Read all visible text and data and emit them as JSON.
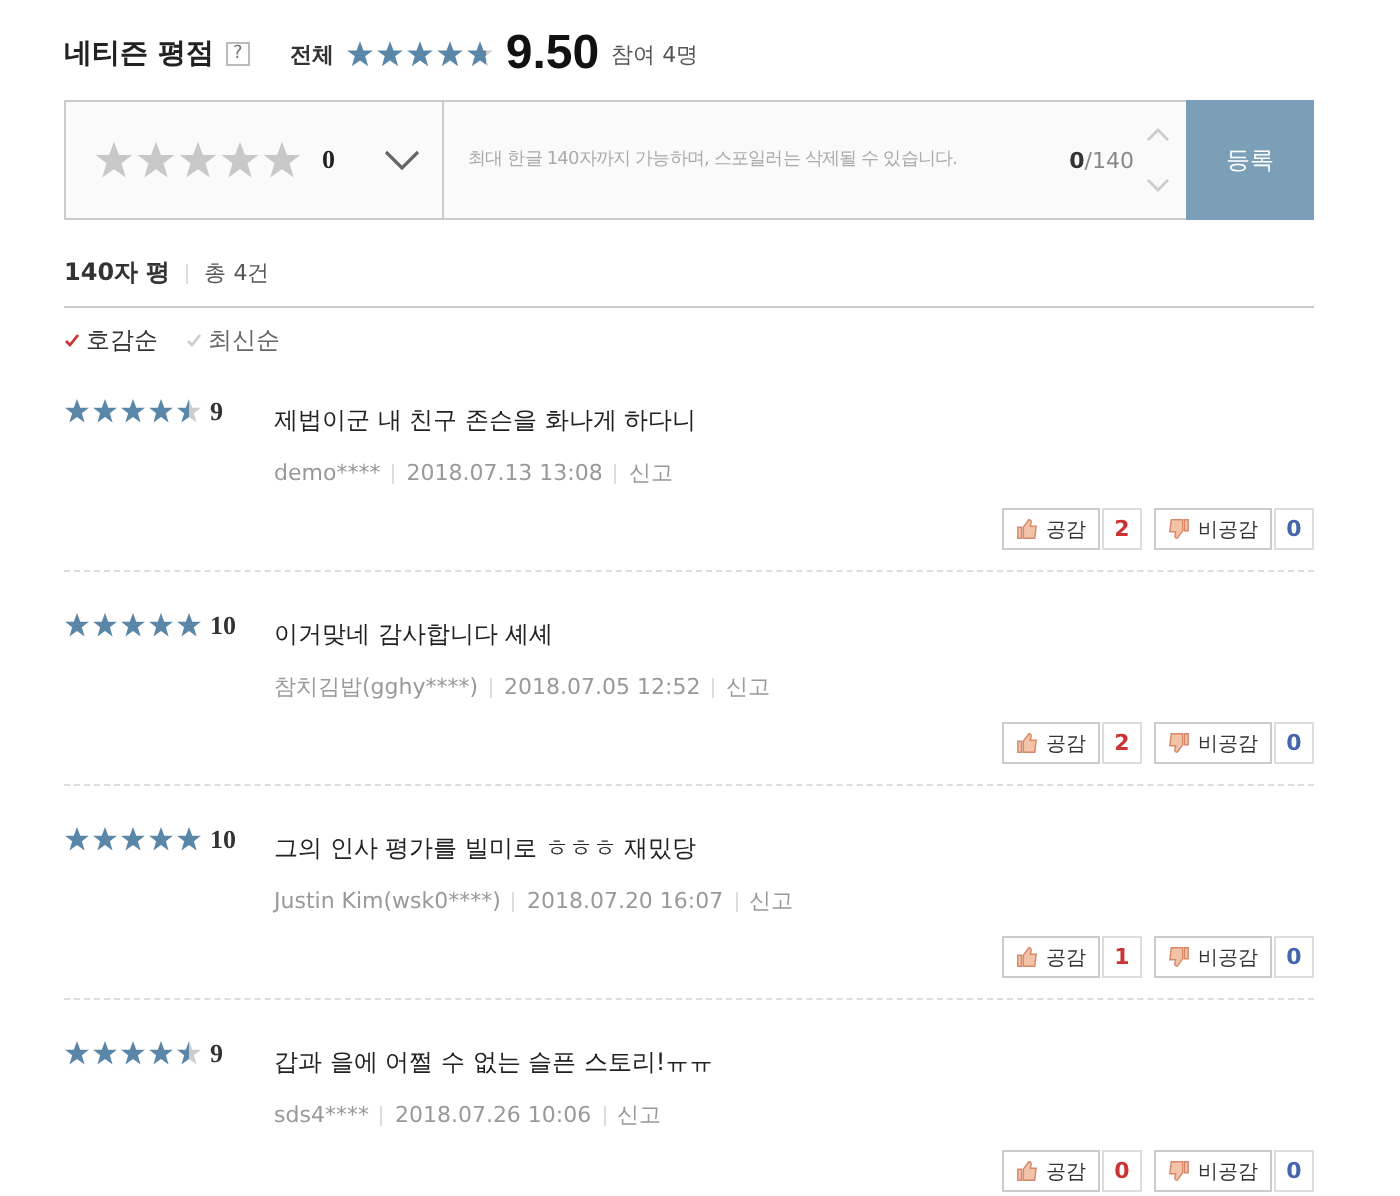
{
  "header": {
    "title": "네티즌 평점",
    "help": "?",
    "scope": "전체",
    "stars": 4.75,
    "score": "9.50",
    "participants": "참여 4명"
  },
  "composer": {
    "stars": 0,
    "rating": "0",
    "placeholder": "최대 한글 140자까지 가능하며, 스포일러는 삭제될 수 있습니다.",
    "count": "0",
    "limit": "/140",
    "submit": "등록"
  },
  "list_header": {
    "title": "140자 평",
    "total": "총 4건"
  },
  "sort": [
    {
      "label": "호감순",
      "selected": true
    },
    {
      "label": "최신순",
      "selected": false
    }
  ],
  "reviews": [
    {
      "stars": 4.5,
      "score": "9",
      "text": "제법이군 내 친구 존슨을 화나게 하다니",
      "author": "demo****",
      "date": "2018.07.13 13:08",
      "report": "신고",
      "like_label": "공감",
      "likes": "2",
      "dislike_label": "비공감",
      "dislikes": "0"
    },
    {
      "stars": 5,
      "score": "10",
      "text": "이거맞네 감사합니다 셰셰",
      "author": "참치김밥(gghy****)",
      "date": "2018.07.05 12:52",
      "report": "신고",
      "like_label": "공감",
      "likes": "2",
      "dislike_label": "비공감",
      "dislikes": "0"
    },
    {
      "stars": 5,
      "score": "10",
      "text": "그의 인사 평가를 빌미로 ㅎㅎㅎ 재밌당",
      "author": "Justin Kim(wsk0****)",
      "date": "2018.07.20 16:07",
      "report": "신고",
      "like_label": "공감",
      "likes": "1",
      "dislike_label": "비공감",
      "dislikes": "0"
    },
    {
      "stars": 4.5,
      "score": "9",
      "text": "갑과 을에 어쩔 수 없는 슬픈 스토리!ㅠㅠ",
      "author": "sds4****",
      "date": "2018.07.26 10:06",
      "report": "신고",
      "like_label": "공감",
      "likes": "0",
      "dislike_label": "비공감",
      "dislikes": "0"
    }
  ]
}
